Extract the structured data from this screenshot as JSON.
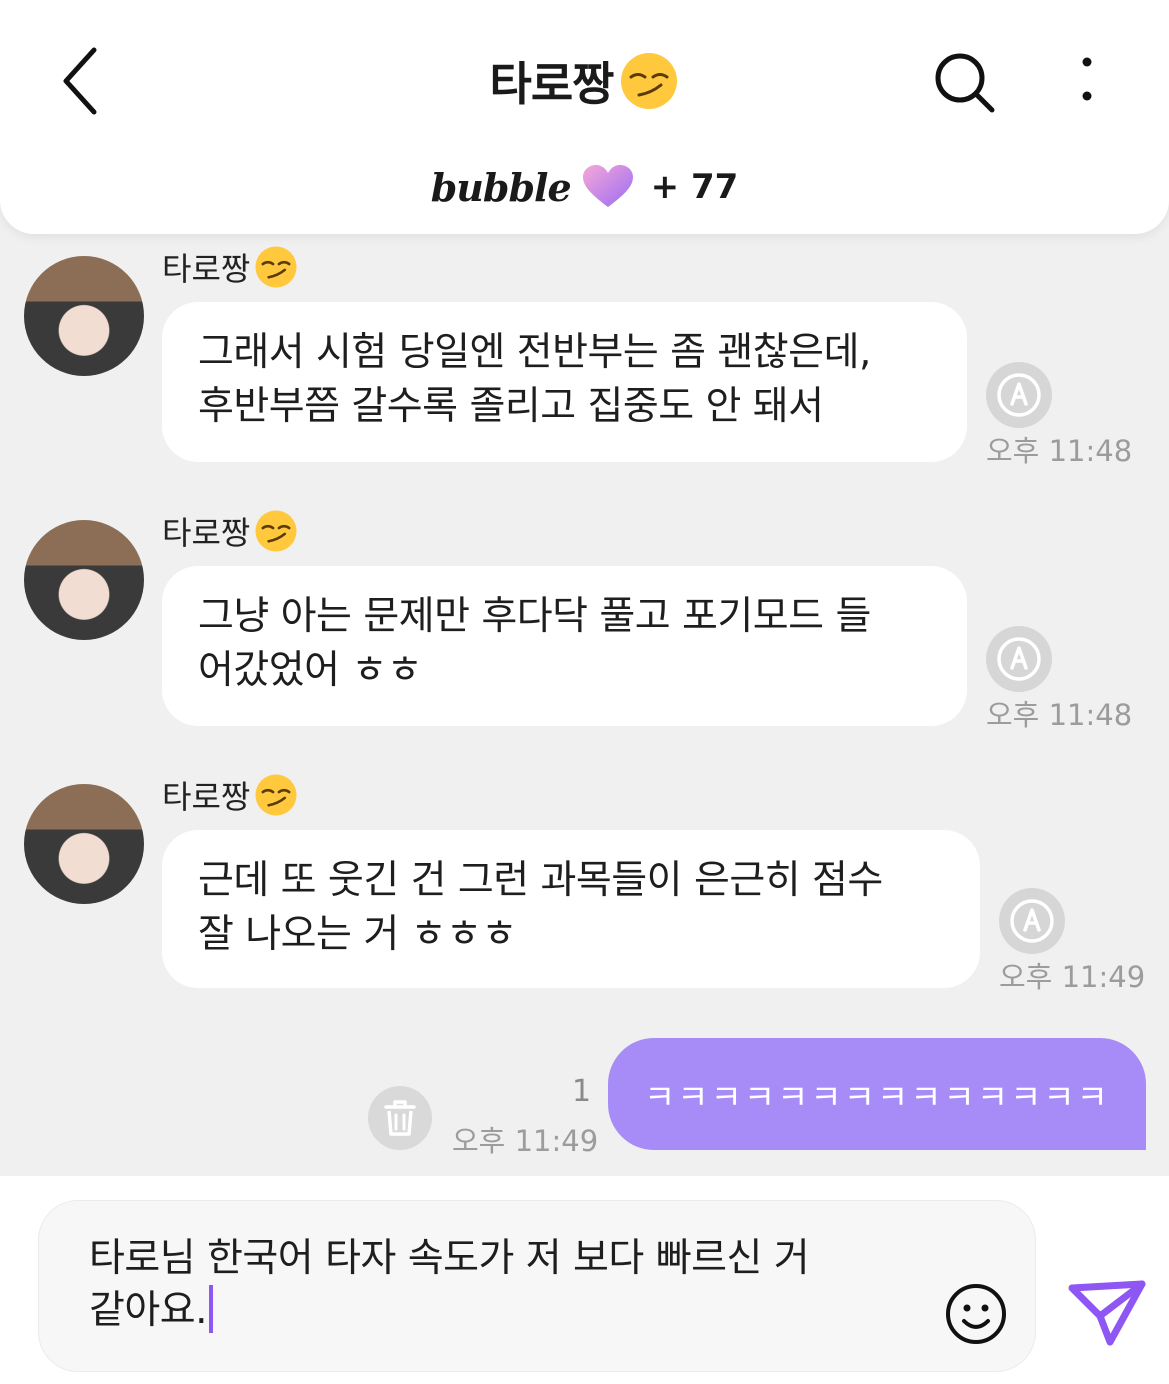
{
  "header": {
    "title": "타로짱",
    "title_emoji": "smirking-face",
    "brand": "bubble",
    "plus_count": "+ 77"
  },
  "messages": [
    {
      "sender": "타로짱",
      "text": "그래서 시험 당일엔 전반부는 좀 괜찮은데,\n후반부쯤 갈수록 졸리고 집중도 안 돼서",
      "time": "오후 11:48"
    },
    {
      "sender": "타로짱",
      "text": "그냥 아는 문제만 후다닥 풀고 포기모드 들\n어갔었어 ㅎㅎ",
      "time": "오후 11:48"
    },
    {
      "sender": "타로짱",
      "text": "근데 또 웃긴 건 그런 과목들이 은근히 점수\n잘 나오는 거 ㅎㅎㅎ",
      "time": "오후 11:49"
    }
  ],
  "outgoing": {
    "text": "ㅋㅋㅋㅋㅋㅋㅋㅋㅋㅋㅋㅋㅋㅋ",
    "unread": "1",
    "time": "오후 11:49"
  },
  "composer": {
    "value": "타로님 한국어 타자 속도가 저 보다 빠르신 거\n같아요."
  },
  "colors": {
    "accent": "#a78bf7",
    "send": "#8e56f2",
    "background": "#f0f0f0"
  },
  "icons": [
    "back-arrow-icon",
    "search-icon",
    "more-vertical-icon",
    "heart-icon",
    "translate-icon",
    "trash-icon",
    "smiley-icon",
    "send-icon"
  ]
}
